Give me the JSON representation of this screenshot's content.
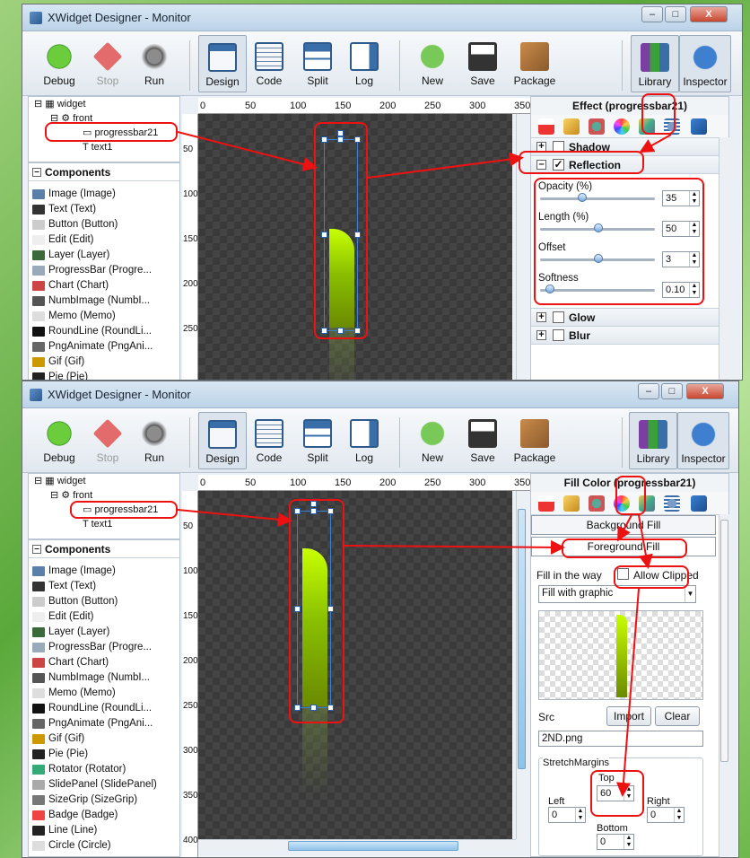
{
  "window": {
    "title": "XWidget Designer - Monitor",
    "min": "–",
    "max": "□",
    "close": "X"
  },
  "toolbar": {
    "debug": "Debug",
    "stop": "Stop",
    "run": "Run",
    "design": "Design",
    "code": "Code",
    "split": "Split",
    "log": "Log",
    "new": "New",
    "save": "Save",
    "package": "Package",
    "library": "Library",
    "inspector": "Inspector"
  },
  "tree": {
    "widget": "widget",
    "front": "front",
    "progressbar": "progressbar21",
    "text": "text1"
  },
  "components": {
    "header": "Components",
    "items_top": [
      "Image (Image)",
      "Text (Text)",
      "Button (Button)",
      "Edit (Edit)",
      "Layer (Layer)",
      "ProgressBar (Progre...",
      "Chart (Chart)",
      "NumbImage (NumbI...",
      "Memo (Memo)",
      "RoundLine (RoundLi...",
      "PngAnimate (PngAni...",
      "Gif (Gif)",
      "Pie (Pie)"
    ],
    "items_bottom": [
      "Image (Image)",
      "Text (Text)",
      "Button (Button)",
      "Edit (Edit)",
      "Layer (Layer)",
      "ProgressBar (Progre...",
      "Chart (Chart)",
      "NumbImage (NumbI...",
      "Memo (Memo)",
      "RoundLine (RoundLi...",
      "PngAnimate (PngAni...",
      "Gif (Gif)",
      "Pie (Pie)",
      "Rotator (Rotator)",
      "SlidePanel (SlidePanel)",
      "SizeGrip (SizeGrip)",
      "Badge (Badge)",
      "Line (Line)",
      "Circle (Circle)"
    ]
  },
  "ruler": {
    "h": [
      "0",
      "50",
      "100",
      "150",
      "200",
      "250",
      "300",
      "350"
    ],
    "v_top": [
      "50",
      "100",
      "150",
      "200",
      "250"
    ],
    "v_bottom": [
      "50",
      "100",
      "150",
      "200",
      "250",
      "300",
      "350",
      "400"
    ]
  },
  "effect": {
    "title": "Effect (progressbar21)",
    "shadow": "Shadow",
    "reflection": "Reflection",
    "reflection_checked": "✓",
    "opacity_label": "Opacity (%)",
    "opacity": "35",
    "opacity_level": 0.35,
    "length_label": "Length (%)",
    "length": "50",
    "length_level": 0.5,
    "offset_label": "Offset",
    "offset": "3",
    "offset_level": 0.5,
    "softness_label": "Softness",
    "softness": "0.10",
    "softness_level": 0.05,
    "glow": "Glow",
    "blur": "Blur"
  },
  "fill": {
    "title": "Fill Color (progressbar21)",
    "background": "Background Fill",
    "foreground": "Foreground Fill",
    "way_label": "Fill in the way",
    "allow_clipped": "Allow Clipped",
    "way_value": "Fill with graphic",
    "src_label": "Src",
    "import": "Import",
    "clear": "Clear",
    "src_value": "2ND.png",
    "stretch": "StretchMargins",
    "top_label": "Top",
    "top": "60",
    "left_label": "Left",
    "left": "0",
    "right_label": "Right",
    "right": "0",
    "bottom_label": "Bottom",
    "bottom": "0"
  },
  "colors": {
    "accent": "#e11111",
    "bar_top": "#c8ff00",
    "bar_bottom": "#6a8a00"
  }
}
